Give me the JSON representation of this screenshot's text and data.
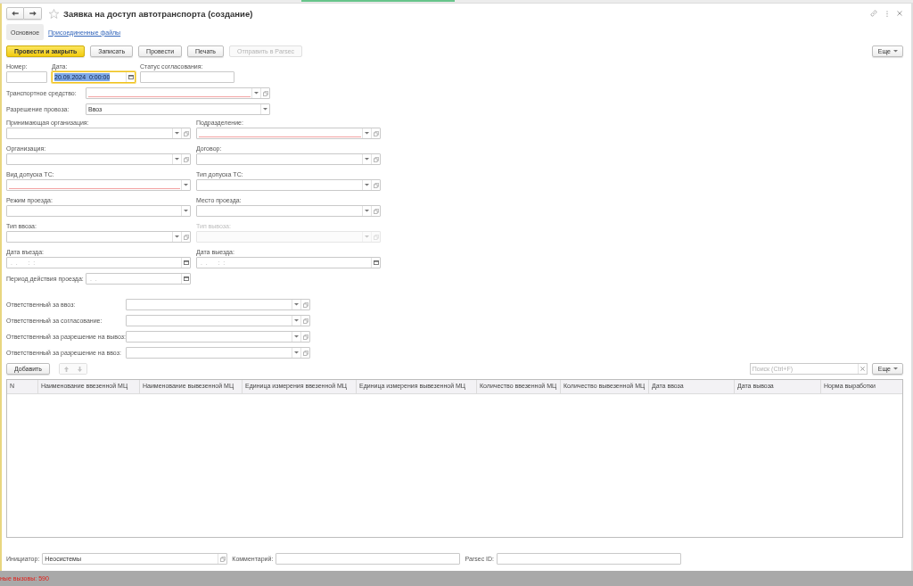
{
  "window": {
    "title": "Заявка на доступ автотранспорта (создание)",
    "favorite": false
  },
  "tabs": [
    {
      "label": "Основное",
      "selected": true
    },
    {
      "label": "Присоединенные файлы",
      "selected": false
    }
  ],
  "toolbar": {
    "buttons": [
      {
        "label": "Провести и закрыть",
        "default": true,
        "disabled": false
      },
      {
        "label": "Записать",
        "default": false,
        "disabled": false
      },
      {
        "label": "Провести",
        "default": false,
        "disabled": false
      },
      {
        "label": "Печать",
        "default": false,
        "disabled": false
      },
      {
        "label": "Отправить в Parsec",
        "default": false,
        "disabled": true
      }
    ],
    "more_button": "Еще"
  },
  "header_fields": [
    {
      "label": "Номер:",
      "kind": "text",
      "focused": false
    },
    {
      "label": "Дата:",
      "kind": "date",
      "value": "20.09.2024  0:00:00",
      "focused": true
    },
    {
      "label": "Статус согласования:",
      "kind": "text",
      "focused": false
    }
  ],
  "main_fields": [
    {
      "label": "Транспортное средство:",
      "kind": "reference",
      "required": true
    },
    {
      "label": "Разрешение провоза:",
      "kind": "select",
      "value": "Ввоз",
      "required": false
    }
  ],
  "grid_fields": [
    {
      "label": "Принимающая организация:",
      "kind": "reference",
      "required": false,
      "disabled": false
    },
    {
      "label": "Подразделение:",
      "kind": "reference",
      "required": true,
      "disabled": false
    },
    {
      "label": "Организация:",
      "kind": "reference",
      "required": false,
      "disabled": false
    },
    {
      "label": "Договор:",
      "kind": "reference",
      "required": false,
      "disabled": false
    },
    {
      "label": "Вид допуска ТС:",
      "kind": "select",
      "required": true,
      "disabled": false
    },
    {
      "label": "Тип допуска ТС:",
      "kind": "reference",
      "required": false,
      "disabled": false
    },
    {
      "label": "Режим проезда:",
      "kind": "select",
      "required": false,
      "disabled": false
    },
    {
      "label": "Место проезда:",
      "kind": "reference",
      "required": false,
      "disabled": false
    },
    {
      "label": "Тип ввоза:",
      "kind": "reference",
      "required": false,
      "disabled": false
    },
    {
      "label": "Тип вывоза:",
      "kind": "reference",
      "required": false,
      "disabled": true
    },
    {
      "label": "Дата въезда:",
      "kind": "date",
      "placeholder": " .  .      :  :",
      "required": false,
      "disabled": false
    },
    {
      "label": "Дата выезда:",
      "kind": "date",
      "placeholder": " .  .      :  :",
      "required": false,
      "disabled": false
    }
  ],
  "period_field": {
    "label": "Период действия проезда:",
    "kind": "date",
    "placeholder": " .  ."
  },
  "responsible_fields": [
    {
      "label": "Ответственный за ввоз:",
      "kind": "reference"
    },
    {
      "label": "Ответственный за согласование:",
      "kind": "reference"
    },
    {
      "label": "Ответственный за разрешение на вывоз:",
      "kind": "reference"
    },
    {
      "label": "Ответственный за разрешение на ввоз:",
      "kind": "reference"
    }
  ],
  "table": {
    "add_button": "Добавить",
    "move_buttons": [
      {
        "kind": "up",
        "disabled": true
      },
      {
        "kind": "down",
        "disabled": true
      }
    ],
    "search": {
      "placeholder": "Поиск (Ctrl+F)"
    },
    "more_button": "Еще",
    "columns": [
      "N",
      "Наименование ввезенной МЦ",
      "Наименование вывезенной МЦ",
      "Единица измерения ввезенной МЦ",
      "Единица измерения вывезенной МЦ",
      "Количество ввезенной МЦ",
      "Количество вывезенной МЦ",
      "Дата ввоза",
      "Дата вывоза",
      "Норма выработки"
    ]
  },
  "footer_fields": [
    {
      "label": "Инициатор:",
      "kind": "link",
      "value": "Неосистемы"
    },
    {
      "label": "Комментарий:",
      "kind": "text"
    },
    {
      "label": "Parsec ID:",
      "kind": "text"
    }
  ],
  "status_bar": {
    "text": "ные вызовы: 590"
  }
}
